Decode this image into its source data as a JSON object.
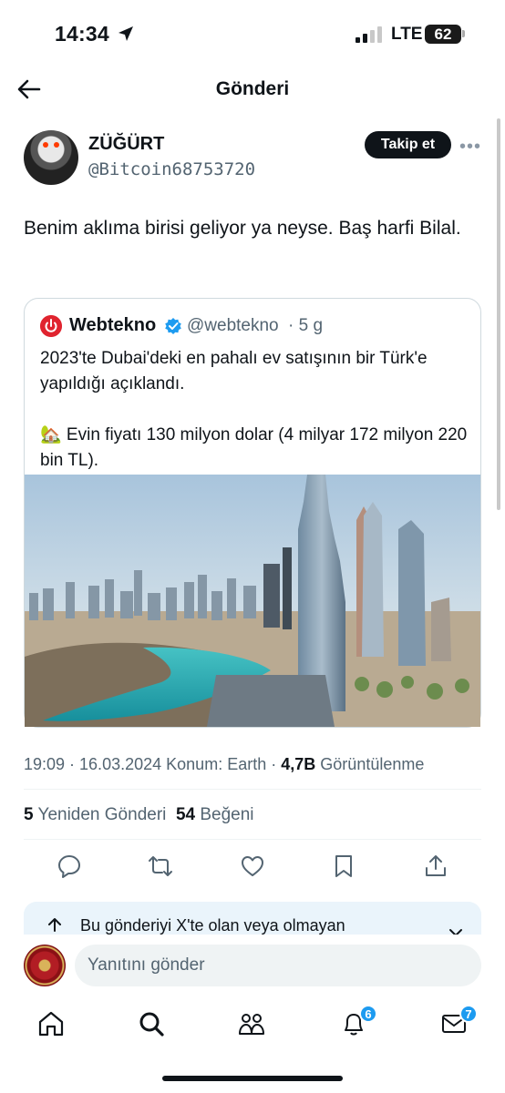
{
  "status_bar": {
    "time": "14:34",
    "network": "LTE",
    "battery": "62"
  },
  "header": {
    "title": "Gönderi"
  },
  "author": {
    "name": "ZÜĞÜRT",
    "handle": "@Bitcoin68753720",
    "follow_label": "Takip et"
  },
  "tweet": {
    "text": "Benim aklıma birisi geliyor ya neyse. Baş harfi Bilal."
  },
  "quoted": {
    "name": "Webtekno",
    "handle": "@webtekno",
    "time": "· 5 g",
    "text_line1": "2023'te Dubai'deki en pahalı ev satışının bir Türk'e yapıldığı açıklandı.",
    "text_line2": "🏡 Evin fiyatı 130 milyon dolar (4 milyar 172 milyon 220 bin TL)."
  },
  "meta": {
    "timestamp": "19:09 · 16.03.2024",
    "location": "Konum: Earth",
    "dot": "·",
    "views": "4,7B",
    "views_label": "Görüntülenme"
  },
  "stats": {
    "reposts": "5",
    "reposts_label": "Yeniden Gönderi",
    "likes": "54",
    "likes_label": "Beğeni"
  },
  "banner": {
    "text": "Bu gönderiyi X'te olan veya olmayan"
  },
  "reply": {
    "placeholder": "Yanıtını gönder"
  },
  "tabs": {
    "notifications_badge": "6",
    "messages_badge": "7"
  },
  "colors": {
    "accent": "#1d9bf0",
    "text": "#0f1419",
    "muted": "#536471",
    "webtekno_red": "#e0242f"
  }
}
